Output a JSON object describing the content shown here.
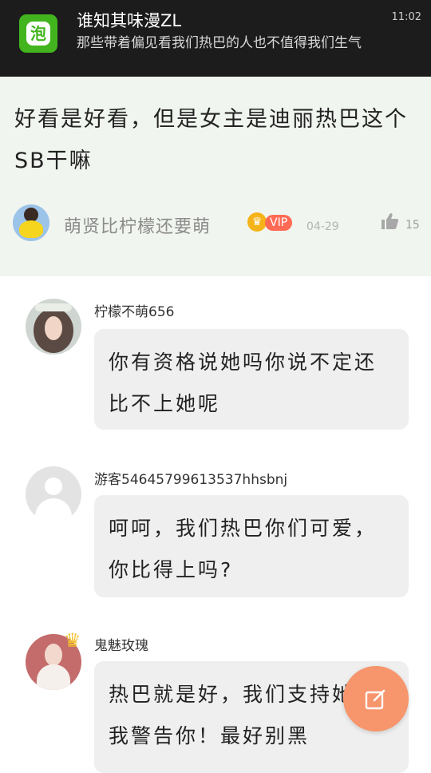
{
  "notification": {
    "app_icon": "paopao-app-icon",
    "title": "谁知其味漫ZL",
    "body": "那些带着偏见看我们热巴的人也不值得我们生气",
    "time": "11:02"
  },
  "post": {
    "content": "好看是好看，但是女主是迪丽热巴这个SB干嘛",
    "author": "萌贤比柠檬还要萌",
    "vip_label": "VIP",
    "date": "04-29",
    "likes": "15"
  },
  "replies": [
    {
      "name": "柠檬不萌656",
      "text": "你有资格说她吗你说不定还比不上她呢"
    },
    {
      "name": "游客54645799613537hhsbnj",
      "text": "呵呵，我们热巴你们可爱，你比得上吗?"
    },
    {
      "name": "鬼魅玫瑰",
      "text": "热巴就是好，我们支持她！我警告你！最好别黑"
    }
  ],
  "colors": {
    "post_bg": "#f1f5ef",
    "bubble_bg": "#efefef",
    "fab": "#f7956c",
    "vip": "#ff6a55",
    "app_green": "#42b51e"
  },
  "icons": [
    "thumbs-up-icon",
    "edit-icon",
    "crown-icon"
  ]
}
